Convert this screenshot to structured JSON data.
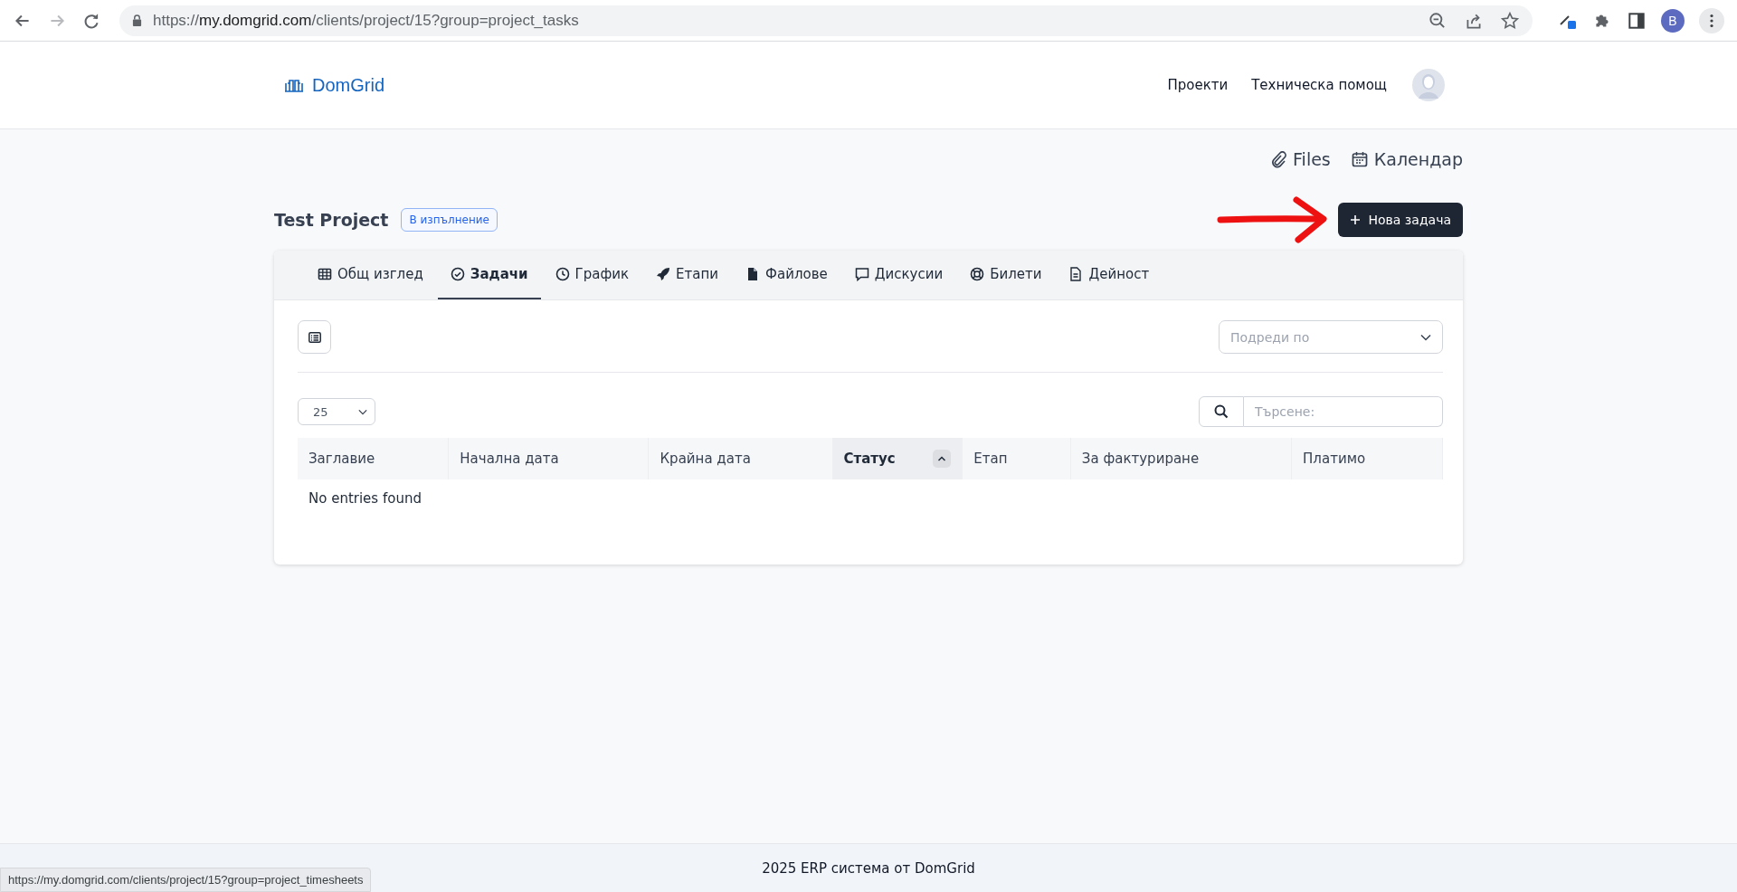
{
  "browser": {
    "url_scheme": "https://",
    "url_host": "my.domgrid.com",
    "url_path": "/clients/project/15?group=project_tasks",
    "profile_initial": "B",
    "forward_disabled": true
  },
  "header": {
    "logo": "DomGrid",
    "nav": [
      "Проекти",
      "Техническа помощ"
    ]
  },
  "quick_links": [
    "Files",
    "Календар"
  ],
  "project": {
    "title": "Test Project",
    "status": "В изпълнение",
    "new_button": "Нова задача"
  },
  "tabs": [
    {
      "label": "Общ изглед",
      "selected": false
    },
    {
      "label": "Задачи",
      "selected": true
    },
    {
      "label": "График",
      "selected": false
    },
    {
      "label": "Етапи",
      "selected": false
    },
    {
      "label": "Файлове",
      "selected": false
    },
    {
      "label": "Дискусии",
      "selected": false
    },
    {
      "label": "Билети",
      "selected": false
    },
    {
      "label": "Дейност",
      "selected": false
    }
  ],
  "sort_select": {
    "placeholder": "Подреди по"
  },
  "page_size": "25",
  "search": {
    "placeholder": "Търсене:"
  },
  "table": {
    "columns": [
      {
        "label": "Заглавие",
        "sorted": false
      },
      {
        "label": "Начална дата",
        "sorted": false
      },
      {
        "label": "Крайна дата",
        "sorted": false
      },
      {
        "label": "Статус",
        "sorted": true
      },
      {
        "label": "Етап",
        "sorted": false
      },
      {
        "label": "За фактуриране",
        "sorted": false
      },
      {
        "label": "Платимо",
        "sorted": false
      }
    ],
    "empty_message": "No entries found"
  },
  "footer": "2025 ERP система от DomGrid",
  "status_url": "https://my.domgrid.com/clients/project/15?group=project_timesheets"
}
